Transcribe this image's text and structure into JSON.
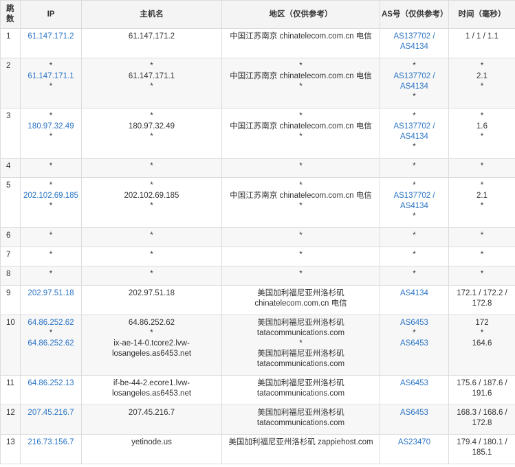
{
  "headers": {
    "hop": "跳数",
    "ip": "IP",
    "host": "主机名",
    "region": "地区（仅供参考）",
    "as": "AS号（仅供参考）",
    "time": "时间（毫秒）"
  },
  "rows": [
    {
      "hop": "1",
      "ip": [
        "61.147.171.2"
      ],
      "host": [
        "61.147.171.2"
      ],
      "region": [
        "中国江苏南京 chinatelecom.com.cn 电信"
      ],
      "as": [
        "AS137702 /",
        "AS4134"
      ],
      "time": [
        "1 / 1 / 1.1"
      ]
    },
    {
      "hop": "2",
      "ip": [
        "*",
        "61.147.171.1",
        "*"
      ],
      "host": [
        "*",
        "61.147.171.1",
        "*"
      ],
      "region": [
        "*",
        "中国江苏南京 chinatelecom.com.cn 电信",
        "*"
      ],
      "as": [
        "*",
        "AS137702 /",
        "AS4134",
        "*"
      ],
      "time": [
        "*",
        "2.1",
        "*"
      ]
    },
    {
      "hop": "3",
      "ip": [
        "*",
        "180.97.32.49",
        "*"
      ],
      "host": [
        "*",
        "180.97.32.49",
        "*"
      ],
      "region": [
        "*",
        "中国江苏南京 chinatelecom.com.cn 电信",
        "*"
      ],
      "as": [
        "*",
        "AS137702 /",
        "AS4134",
        "*"
      ],
      "time": [
        "*",
        "1.6",
        "*"
      ]
    },
    {
      "hop": "4",
      "ip": [
        "*"
      ],
      "host": [
        "*"
      ],
      "region": [
        "*"
      ],
      "as": [
        "*"
      ],
      "time": [
        "*"
      ]
    },
    {
      "hop": "5",
      "ip": [
        "*",
        "202.102.69.185",
        "*"
      ],
      "host": [
        "*",
        "202.102.69.185",
        "*"
      ],
      "region": [
        "*",
        "中国江苏南京 chinatelecom.com.cn 电信",
        "*"
      ],
      "as": [
        "*",
        "AS137702 /",
        "AS4134",
        "*"
      ],
      "time": [
        "*",
        "2.1",
        "*"
      ]
    },
    {
      "hop": "6",
      "ip": [
        "*"
      ],
      "host": [
        "*"
      ],
      "region": [
        "*"
      ],
      "as": [
        "*"
      ],
      "time": [
        "*"
      ]
    },
    {
      "hop": "7",
      "ip": [
        "*"
      ],
      "host": [
        "*"
      ],
      "region": [
        "*"
      ],
      "as": [
        "*"
      ],
      "time": [
        "*"
      ]
    },
    {
      "hop": "8",
      "ip": [
        "*"
      ],
      "host": [
        "*"
      ],
      "region": [
        "*"
      ],
      "as": [
        "*"
      ],
      "time": [
        "*"
      ]
    },
    {
      "hop": "9",
      "ip": [
        "202.97.51.18"
      ],
      "host": [
        "202.97.51.18"
      ],
      "region": [
        "美国加利福尼亚州洛杉矶",
        "chinatelecom.com.cn 电信"
      ],
      "as": [
        "AS4134"
      ],
      "time": [
        "172.1 / 172.2 /",
        "172.8"
      ]
    },
    {
      "hop": "10",
      "ip": [
        "64.86.252.62",
        "*",
        "64.86.252.62"
      ],
      "host": [
        "64.86.252.62",
        "*",
        "ix-ae-14-0.tcore2.lvw-",
        "losangeles.as6453.net"
      ],
      "region": [
        "美国加利福尼亚州洛杉矶",
        "tatacommunications.com",
        "*",
        "美国加利福尼亚州洛杉矶",
        "tatacommunications.com"
      ],
      "as": [
        "AS6453",
        "*",
        "AS6453"
      ],
      "time": [
        "172",
        "*",
        "164.6"
      ]
    },
    {
      "hop": "11",
      "ip": [
        "64.86.252.13"
      ],
      "host": [
        "if-be-44-2.ecore1.lvw-",
        "losangeles.as6453.net"
      ],
      "region": [
        "美国加利福尼亚州洛杉矶",
        "tatacommunications.com"
      ],
      "as": [
        "AS6453"
      ],
      "time": [
        "175.6 / 187.6 /",
        "191.6"
      ]
    },
    {
      "hop": "12",
      "ip": [
        "207.45.216.7"
      ],
      "host": [
        "207.45.216.7"
      ],
      "region": [
        "美国加利福尼亚州洛杉矶",
        "tatacommunications.com"
      ],
      "as": [
        "AS6453"
      ],
      "time": [
        "168.3 / 168.6 /",
        "172.8"
      ]
    },
    {
      "hop": "13",
      "ip": [
        "216.73.156.7"
      ],
      "host": [
        "yetinode.us"
      ],
      "region": [
        "美国加利福尼亚州洛杉矶 zappiehost.com"
      ],
      "as": [
        "AS23470"
      ],
      "time": [
        "179.4 / 180.1 /",
        "185.1"
      ]
    }
  ],
  "colors": {
    "link": "#2a74c6",
    "border": "#dcdcdc",
    "header_bg": "#f4f4f4",
    "row_alt_bg": "#f7f7f7"
  }
}
